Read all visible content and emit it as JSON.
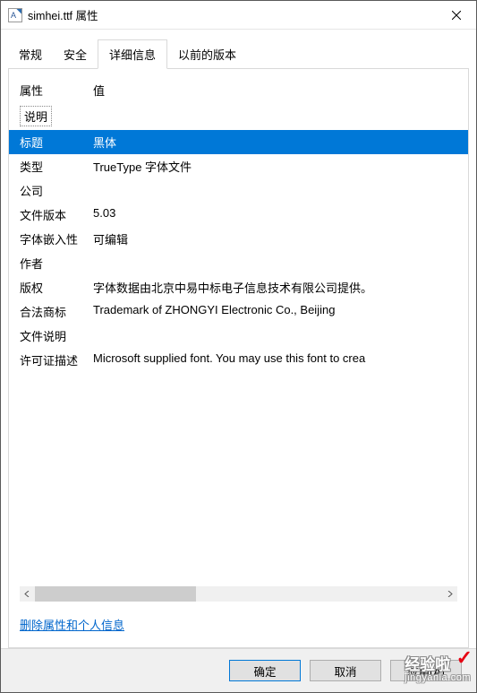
{
  "window": {
    "title": "simhei.ttf 属性",
    "close_aria": "关闭"
  },
  "tabs": {
    "general": "常规",
    "security": "安全",
    "details": "详细信息",
    "previous": "以前的版本"
  },
  "headers": {
    "property": "属性",
    "value": "值"
  },
  "group": {
    "description": "说明"
  },
  "rows": {
    "title": {
      "k": "标题",
      "v": "黑体"
    },
    "type": {
      "k": "类型",
      "v": "TrueType 字体文件"
    },
    "company": {
      "k": "公司",
      "v": ""
    },
    "filever": {
      "k": "文件版本",
      "v": "5.03"
    },
    "embed": {
      "k": "字体嵌入性",
      "v": "可编辑"
    },
    "author": {
      "k": "作者",
      "v": ""
    },
    "copyright": {
      "k": "版权",
      "v": "字体数据由北京中易中标电子信息技术有限公司提供。"
    },
    "trademark": {
      "k": "合法商标",
      "v": "Trademark of ZHONGYI Electronic Co., Beijing"
    },
    "filedesc": {
      "k": "文件说明",
      "v": ""
    },
    "license": {
      "k": "许可证描述",
      "v": "Microsoft supplied font. You may use this font to crea"
    }
  },
  "link": {
    "remove": "删除属性和个人信息"
  },
  "buttons": {
    "ok": "确定",
    "cancel": "取消",
    "apply": "应用(A)"
  },
  "watermark": {
    "brand": "经验啦",
    "url": "jingyanla.com"
  }
}
